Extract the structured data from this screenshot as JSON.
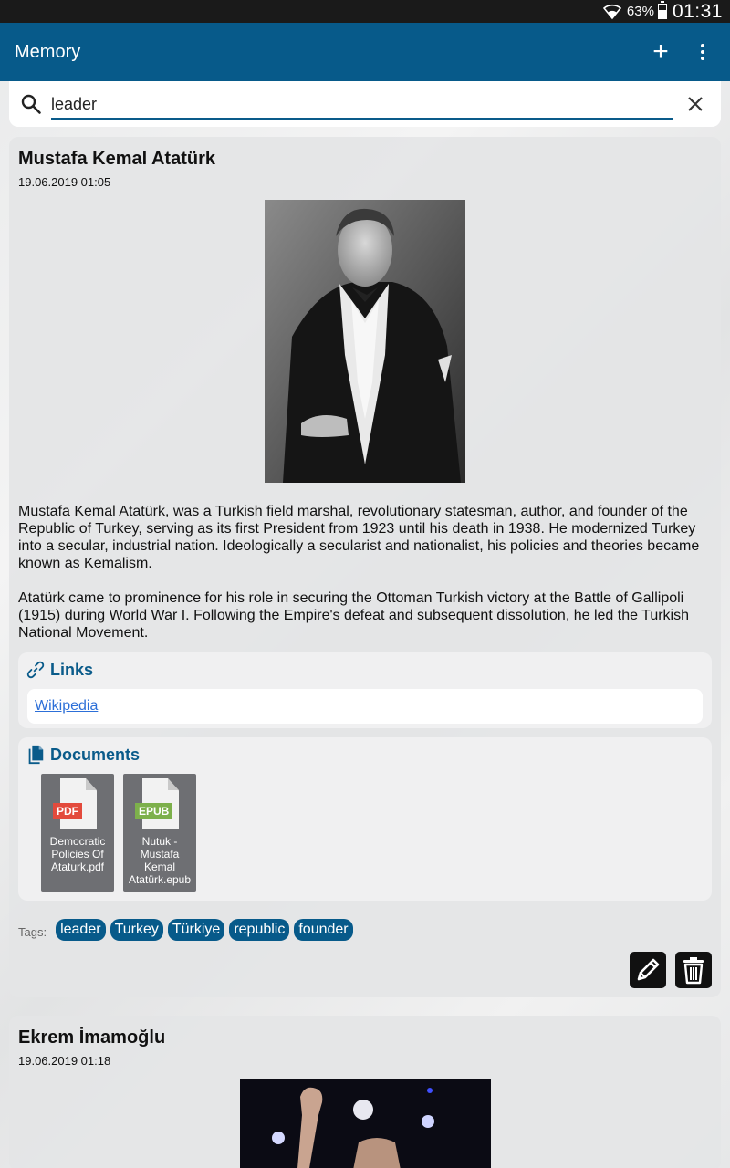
{
  "status": {
    "battery_pct": "63%",
    "time": "01:31"
  },
  "appbar": {
    "title": "Memory",
    "icons": [
      "plus-icon",
      "more-vert-icon"
    ]
  },
  "search": {
    "value": "leader",
    "icons": [
      "search-icon",
      "close-icon"
    ]
  },
  "memories": [
    {
      "name": "Mustafa Kemal Atatürk",
      "date": "19.06.2019 01:05",
      "description": [
        "Mustafa Kemal Atatürk, was a Turkish field marshal, revolutionary statesman, author, and founder of the Republic of Turkey, serving as its first President from 1923 until his death in 1938. He modernized Turkey into a secular, industrial nation. Ideologically a secularist and nationalist, his policies and theories became known as Kemalism.",
        "Atatürk came to prominence for his role in securing the Ottoman Turkish victory at the Battle of Gallipoli (1915) during World War I. Following the Empire's defeat and subsequent dissolution, he led the Turkish National Movement."
      ],
      "links_label": "Links",
      "links": [
        "Wikipedia"
      ],
      "documents_label": "Documents",
      "documents": [
        {
          "type": "PDF",
          "name": "Democratic Policies Of Ataturk.pdf"
        },
        {
          "type": "EPUB",
          "name": "Nutuk - Mustafa Kemal Atatürk.epub"
        }
      ],
      "tags_label": "Tags:",
      "tags": [
        "leader",
        "Turkey",
        "Türkiye",
        "republic",
        "founder"
      ],
      "action_icons": [
        "edit-pencil-icon",
        "delete-trash-icon"
      ]
    },
    {
      "name": "Ekrem İmamoğlu",
      "date": "19.06.2019 01:18"
    }
  ]
}
